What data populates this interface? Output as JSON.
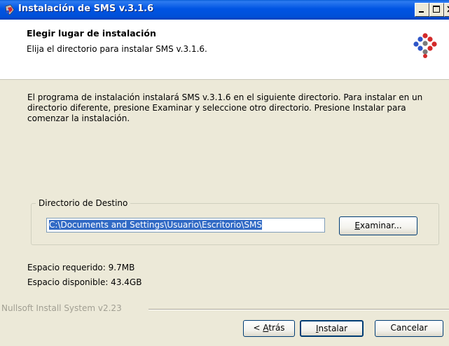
{
  "window": {
    "title": "Instalación de SMS v.3.1.6",
    "icon": "installer-icon",
    "controls": [
      "minimize",
      "maximize",
      "close"
    ]
  },
  "header": {
    "title": "Elegir lugar de instalación",
    "subtitle": "Elija el directorio para instalar SMS v.3.1.6.",
    "logo": "sms-logo"
  },
  "body": {
    "description": "El programa de instalación instalará SMS v.3.1.6 en el siguiente directorio. Para instalar en un directorio diferente, presione Examinar y seleccione otro directorio. Presione Instalar para comenzar la instalación.",
    "destination": {
      "group_label": "Directorio de Destino",
      "path": "C:\\Documents and Settings\\Usuario\\Escritorio\\SMS",
      "browse_label_underlined": "E",
      "browse_label_rest": "xaminar..."
    },
    "space_required": "Espacio requerido: 9.7MB",
    "space_available": "Espacio disponible: 43.4GB"
  },
  "footer": {
    "branding": "Nullsoft Install System v2.23",
    "back_prefix": "< ",
    "back_underlined": "A",
    "back_rest": "trás",
    "install_underlined": "I",
    "install_rest": "nstalar",
    "cancel_label": "Cancelar"
  },
  "colors": {
    "titlebar": "#0054e3",
    "dialog": "#ece9d8",
    "selection": "#316ac5",
    "button_border": "#003c74"
  }
}
